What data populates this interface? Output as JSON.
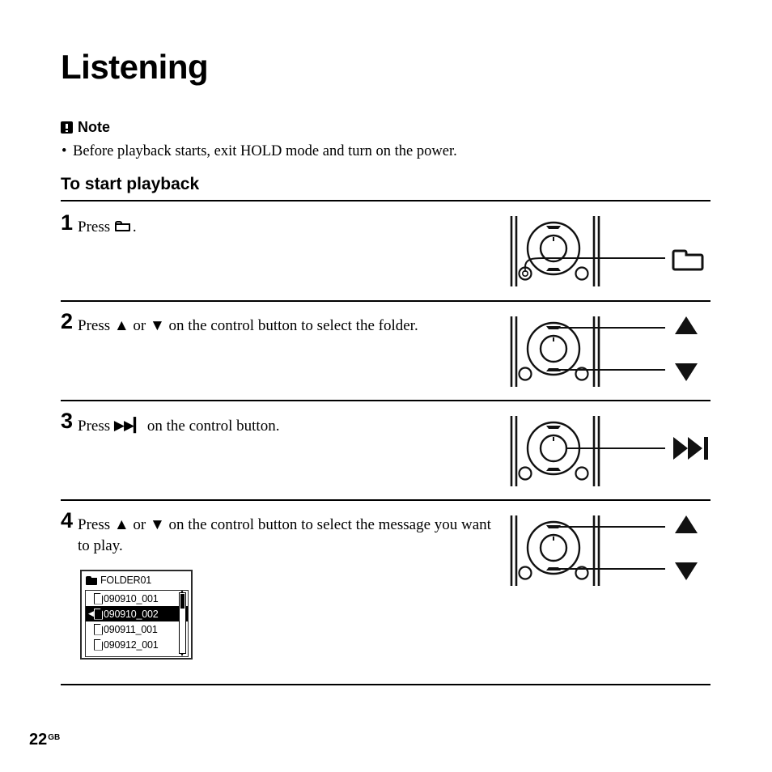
{
  "document": {
    "title": "Listening",
    "page_number": "22",
    "page_region_code": "GB"
  },
  "note": {
    "badge_icon": "exclamation-badge-icon",
    "heading": "Note",
    "bullet_symbol": "•",
    "text": "Before playback starts, exit HOLD mode and turn on the power."
  },
  "section": {
    "heading": "To start playback"
  },
  "steps": [
    {
      "number": "1",
      "text_before": "Press",
      "inline_icon": "folder-icon",
      "text_after": ".",
      "callout_label": "",
      "callout_icon": "folder-icon",
      "illustration": "ic-recorder-control-button"
    },
    {
      "number": "2",
      "text_line1": "Press ▲ or ▼ on the control button to select the folder.",
      "callout_up": "▲",
      "callout_down": "▼",
      "illustration": "ic-recorder-control-button"
    },
    {
      "number": "3",
      "text_before": "Press",
      "inline_symbol": "▶▶▎",
      "text_after": "on the control button.",
      "callout_symbol": "▶▶▎",
      "illustration": "ic-recorder-control-button"
    },
    {
      "number": "4",
      "text_line1": "Press ▲ or ▼ on the control button to select the message",
      "text_line2": "you want to play.",
      "callout_up": "▲",
      "callout_down": "▼",
      "illustration": "ic-recorder-control-button"
    }
  ],
  "lcd_screen": {
    "header_icon": "folder-icon",
    "header_label": "FOLDER01",
    "selection_caret": "◀",
    "rows": [
      {
        "icon": "document-icon",
        "label": "090910_001",
        "selected": false
      },
      {
        "icon": "document-icon",
        "label": "090910_002",
        "selected": true
      },
      {
        "icon": "document-icon",
        "label": "090911_001",
        "selected": false
      },
      {
        "icon": "document-icon",
        "label": "090912_001",
        "selected": false
      }
    ],
    "scrollbar": {
      "up_arrow": "▲",
      "down_arrow": "▼",
      "thumb_position": "top"
    }
  },
  "colors": {
    "ink": "#000000",
    "paper": "#ffffff",
    "lcd_border": "#2a2a2a"
  }
}
